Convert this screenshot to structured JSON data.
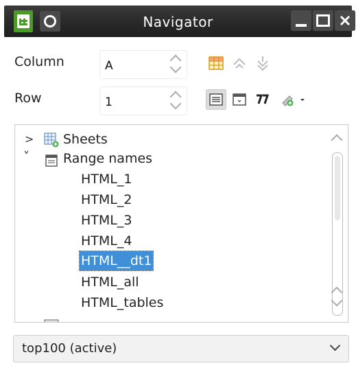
{
  "window": {
    "title": "Navigator"
  },
  "fields": {
    "column_label": "Column",
    "column_value": "A",
    "row_label": "Row",
    "row_value": "1"
  },
  "tree": {
    "sheets_label": "Sheets",
    "range_names_label": "Range names",
    "items": [
      "HTML_1",
      "HTML_2",
      "HTML_3",
      "HTML_4",
      "HTML__dt1",
      "HTML_all",
      "HTML_tables"
    ],
    "selected_item": "HTML__dt1"
  },
  "document_select": {
    "selected": "top100 (active)"
  },
  "colors": {
    "titlebar": "#2a2a2a",
    "selection": "#3f8fd9",
    "app_icon": "#4c9a2a"
  }
}
